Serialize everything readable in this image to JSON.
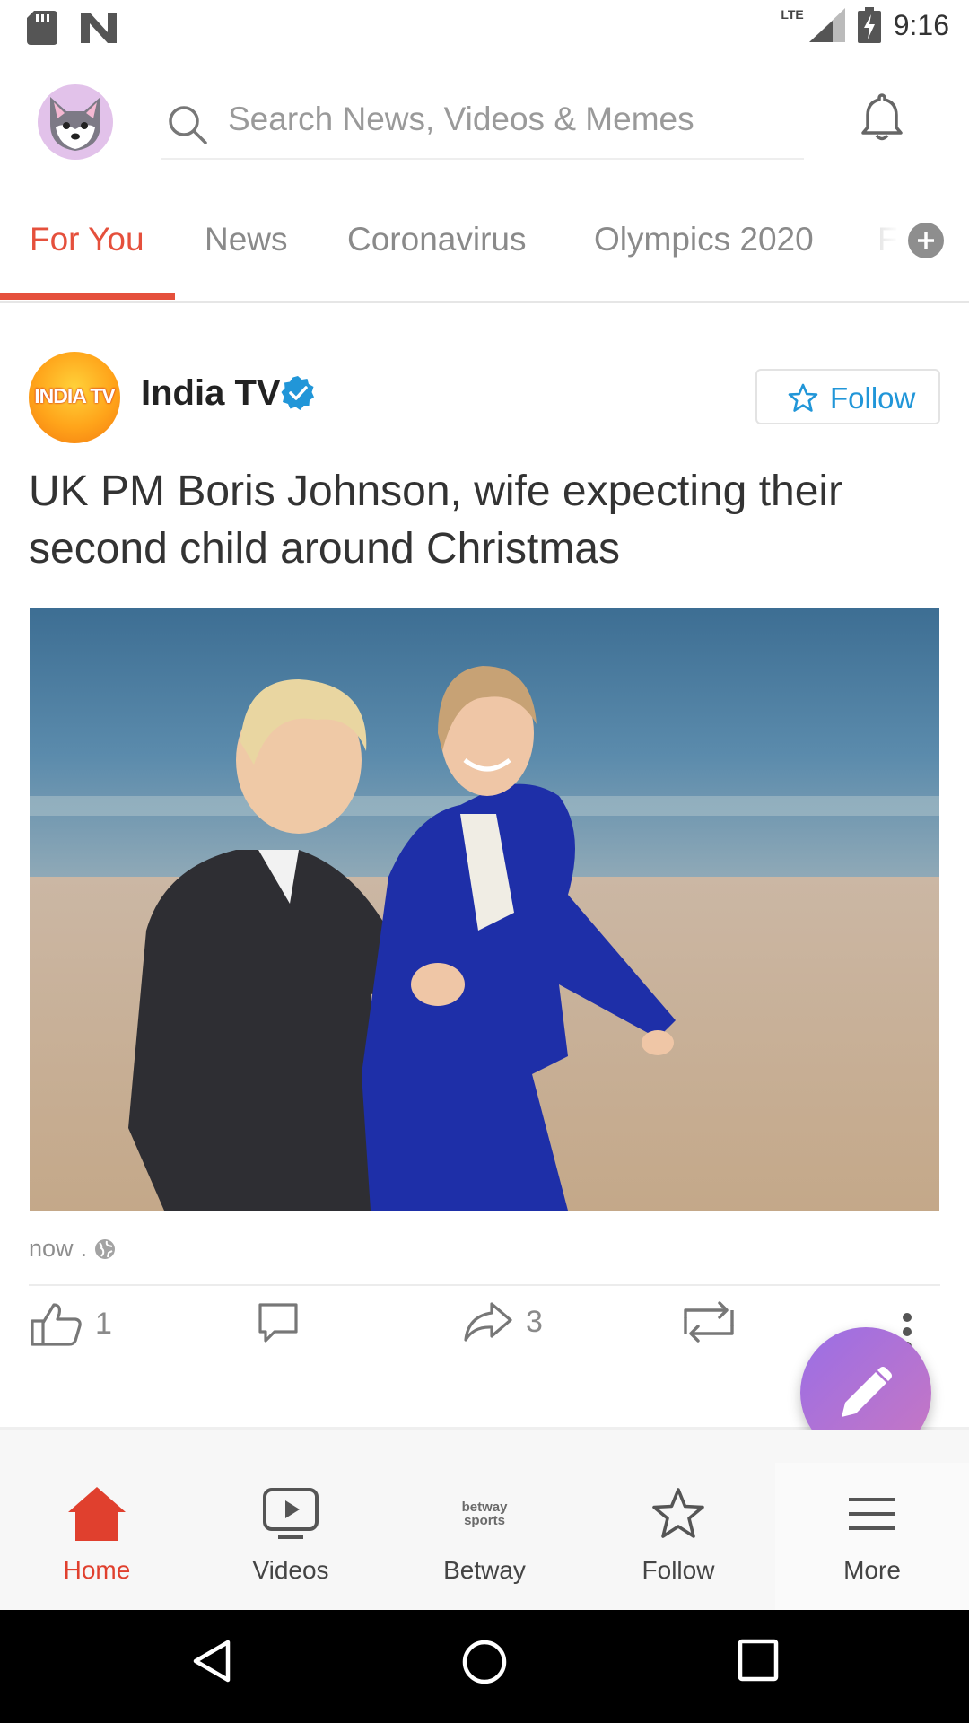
{
  "status_bar": {
    "network": "LTE",
    "time": "9:16"
  },
  "top_bar": {
    "search_placeholder": "Search News, Videos & Memes"
  },
  "tabs": [
    {
      "label": "For You",
      "active": true
    },
    {
      "label": "News",
      "active": false
    },
    {
      "label": "Coronavirus",
      "active": false
    },
    {
      "label": "Olympics 2020",
      "active": false
    },
    {
      "label": "F",
      "active": false
    }
  ],
  "post": {
    "source_logo_text": "INDIA TV",
    "source_name": "India TV",
    "verified": true,
    "follow_label": "Follow",
    "headline": "UK PM Boris Johnson, wife expecting their second child around Christmas",
    "image_icon": "beach-couple-photo",
    "time": "now",
    "time_separator": ".",
    "visibility_icon": "globe-icon",
    "likes": "1",
    "shares": "3"
  },
  "bottom_nav": [
    {
      "label": "Home",
      "icon": "home-icon",
      "active": true
    },
    {
      "label": "Videos",
      "icon": "video-icon",
      "active": false
    },
    {
      "label": "Betway",
      "icon": "betway-sports-logo",
      "active": false
    },
    {
      "label": "Follow",
      "icon": "star-icon",
      "active": false
    },
    {
      "label": "More",
      "icon": "menu-icon",
      "active": false
    }
  ],
  "colors": {
    "accent": "#e5503c",
    "link": "#2196d8",
    "fab_start": "#9a6ee6",
    "fab_end": "#c877c2"
  }
}
